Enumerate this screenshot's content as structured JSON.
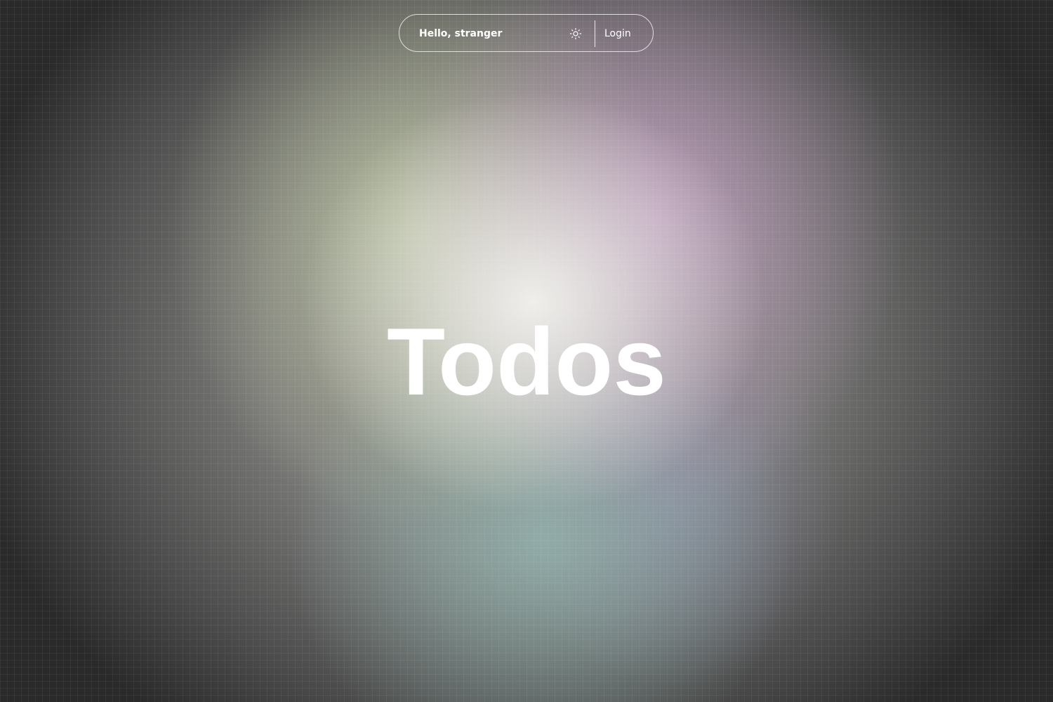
{
  "header": {
    "greeting": "Hello, stranger",
    "theme_icon": "sun-icon",
    "login_label": "Login"
  },
  "hero": {
    "title": "Todos"
  },
  "colors": {
    "text": "#ffffff",
    "background_dark": "#2a2a2a",
    "glow_center": "#f2f2ee",
    "glow_pink": "#c8a0c8",
    "glow_green": "#c3cda5",
    "glow_teal": "#96b9b4"
  }
}
